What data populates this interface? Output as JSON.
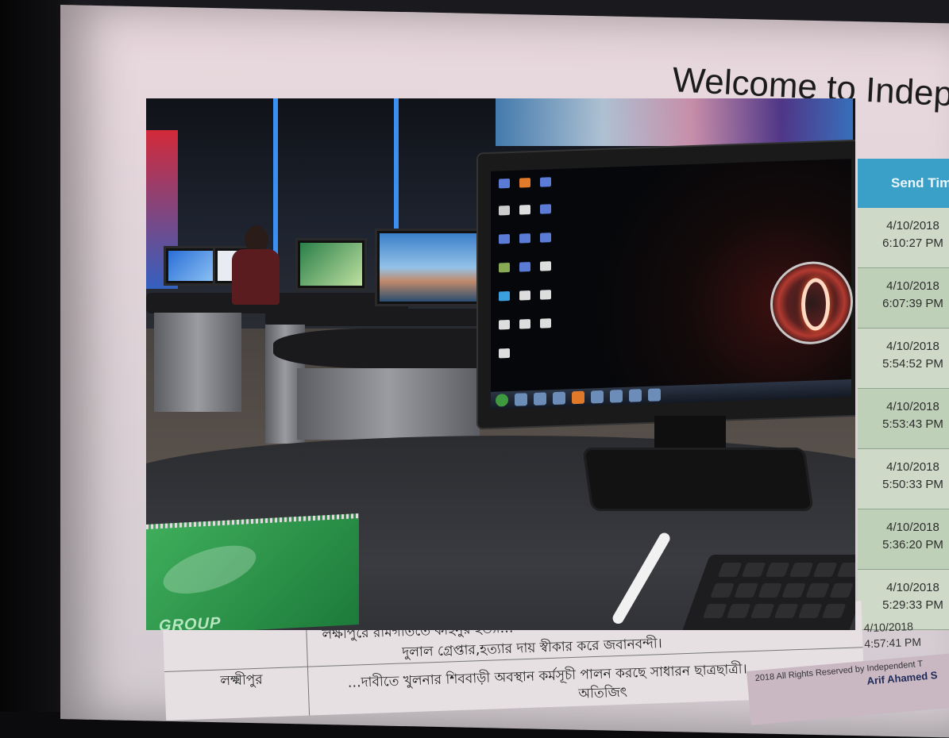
{
  "page": {
    "heading": "Welcome to Indepen",
    "table": {
      "send_time_header": "Send Tim",
      "send_times": [
        [
          "4/10/2018",
          "6:10:27 PM"
        ],
        [
          "4/10/2018",
          "6:07:39 PM"
        ],
        [
          "4/10/2018",
          "5:54:52 PM"
        ],
        [
          "4/10/2018",
          "5:53:43 PM"
        ],
        [
          "4/10/2018",
          "5:50:33 PM"
        ],
        [
          "4/10/2018",
          "5:36:20 PM"
        ],
        [
          "4/10/2018",
          "5:29:33 PM"
        ]
      ],
      "bottom_row": {
        "district": "লক্ষ্মীপুর",
        "line1": "লক্ষীপুরে রামগতিতে কাহনুর হত্যা… ",
        "line2": "দুলাল গ্রেপ্তার,হত্যার দায় স্বীকার করে জবানবন্দী।",
        "line3": "…দাবীতে খুলনার শিববাড়ী অবস্থান কর্মসূচী পালন করছে সাধারন ছাত্রছাত্রী।",
        "line4": "অতিজিৎ",
        "time": [
          "4/10/2018",
          "4:57:41 PM"
        ]
      }
    },
    "footer": {
      "copyright": "2018 All Rights Reserved by Independent T",
      "credit": "Arif Ahamed S"
    }
  },
  "photo": {
    "notebook_brand": "GROUP",
    "colors": {
      "screen_bg": "#e0d4d9",
      "table_header": "#3aa0c7",
      "row_green": "#cfd9c8",
      "notebook_green": "#2a8f47"
    }
  }
}
